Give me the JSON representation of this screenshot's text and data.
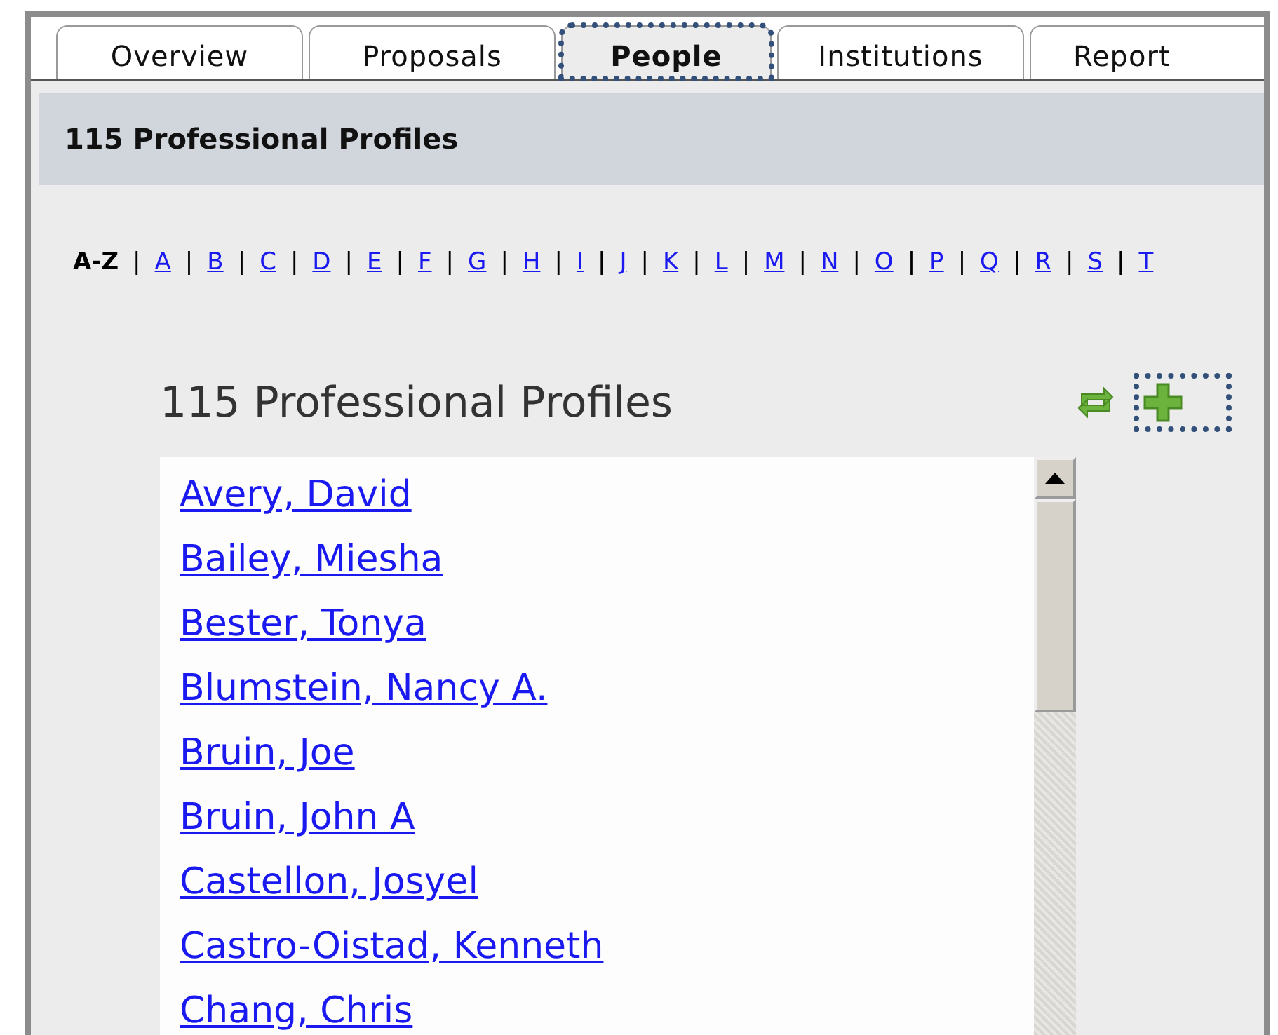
{
  "tabs": [
    {
      "label": "Overview",
      "selected": false
    },
    {
      "label": "Proposals",
      "selected": false
    },
    {
      "label": "People",
      "selected": true
    },
    {
      "label": "Institutions",
      "selected": false
    },
    {
      "label": "Report",
      "selected": false
    }
  ],
  "header": {
    "title": "115 Professional Profiles"
  },
  "alphabet": {
    "label": "A-Z",
    "separator": "|",
    "letters": [
      "A",
      "B",
      "C",
      "D",
      "E",
      "F",
      "G",
      "H",
      "I",
      "J",
      "K",
      "L",
      "M",
      "N",
      "O",
      "P",
      "Q",
      "R",
      "S",
      "T"
    ]
  },
  "list_title": "115 Professional Profiles",
  "people": [
    "Avery, David",
    "Bailey, Miesha",
    "Bester, Tonya",
    "Blumstein, Nancy A.",
    "Bruin, Joe",
    "Bruin, John A",
    "Castellon, Josyel",
    "Castro-Oistad, Kenneth",
    "Chang, Chris"
  ]
}
